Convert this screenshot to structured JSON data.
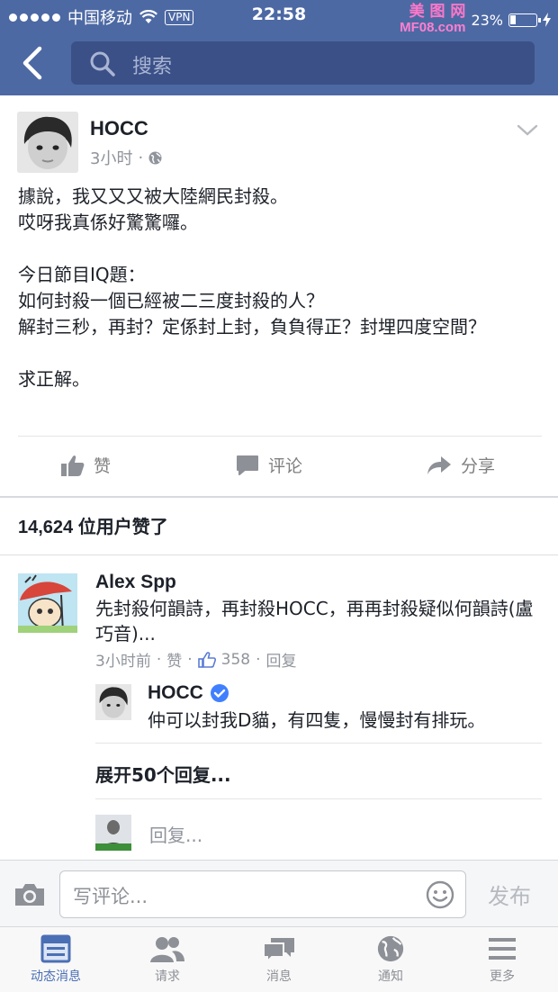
{
  "status_bar": {
    "carrier": "中国移动",
    "vpn": "VPN",
    "time": "22:58",
    "watermark_logo": "美 图 网",
    "watermark_url": "MF08.com",
    "battery_percent_text": "23%"
  },
  "nav": {
    "search_placeholder": "搜索"
  },
  "post": {
    "author": "HOCC",
    "time": "3小时",
    "separator": "·",
    "body": "據說，我又又又被大陸網民封殺。\n哎呀我真係好驚驚囉。\n\n今日節目IQ題：\n如何封殺一個已經被二三度封殺的人？\n解封三秒，再封？定係封上封，負負得正？封埋四度空間？\n\n求正解。",
    "actions": {
      "like": "赞",
      "comment": "评论",
      "share": "分享"
    },
    "likes_count": "14,624",
    "likes_suffix": "位用户赞了"
  },
  "comment": {
    "author": "Alex Spp",
    "text": "先封殺何韻詩，再封殺HOCC，再再封殺疑似何韻詩(盧巧音)...",
    "time": "3小时前",
    "like_label": "赞",
    "like_count": "358",
    "reply_label": "回复",
    "reply": {
      "author": "HOCC",
      "text": "仲可以封我D貓，有四隻，慢慢封有排玩。"
    },
    "expand_label": "展开50个回复...",
    "reply_placeholder": "回复..."
  },
  "composer": {
    "placeholder": "写评论...",
    "publish_label": "发布"
  },
  "tabs": [
    {
      "label": "动态消息",
      "icon": "news-feed-icon",
      "active": true
    },
    {
      "label": "请求",
      "icon": "friend-requests-icon",
      "active": false
    },
    {
      "label": "消息",
      "icon": "messages-icon",
      "active": false
    },
    {
      "label": "通知",
      "icon": "globe-notifications-icon",
      "active": false
    },
    {
      "label": "更多",
      "icon": "menu-icon",
      "active": false
    }
  ],
  "colors": {
    "nav_blue": "#4d69a4",
    "search_bg": "#3b5087",
    "tab_active": "#4b6fb5",
    "verified_blue": "#4080ff"
  }
}
